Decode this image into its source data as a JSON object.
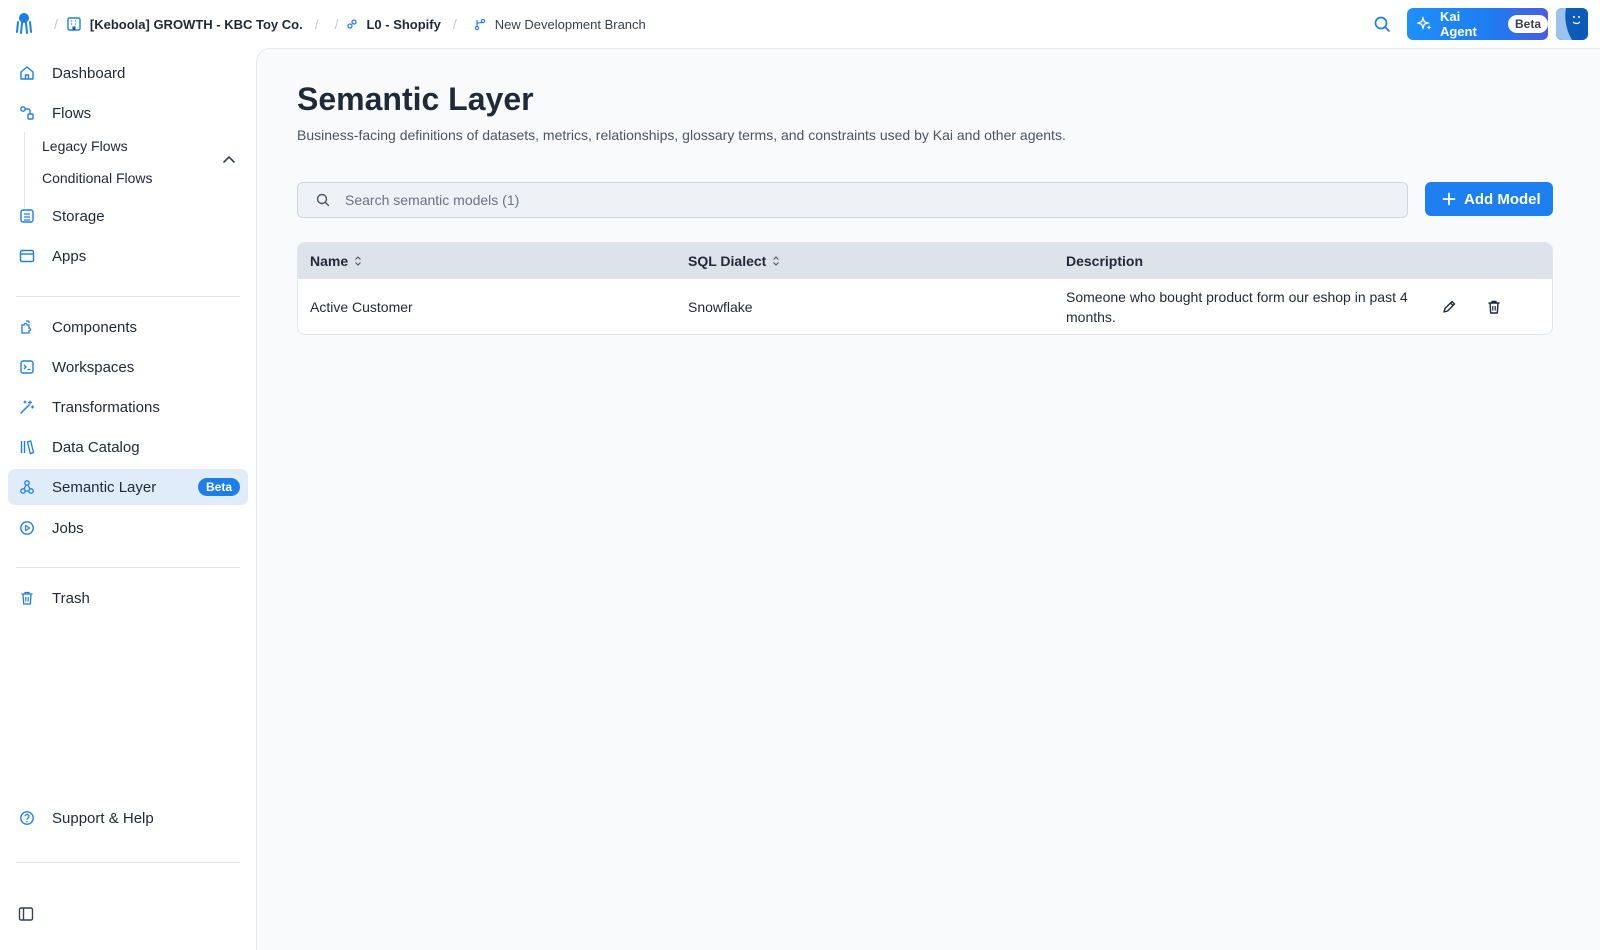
{
  "topbar": {
    "project": "[Keboola] GROWTH - KBC Toy Co.",
    "flow": "L0 - Shopify",
    "branch": "New Development Branch",
    "kai_label": "Kai Agent",
    "kai_badge": "Beta"
  },
  "sidebar": {
    "dashboard": "Dashboard",
    "flows": "Flows",
    "legacy_flows": "Legacy Flows",
    "conditional_flows": "Conditional Flows",
    "storage": "Storage",
    "apps": "Apps",
    "components": "Components",
    "workspaces": "Workspaces",
    "transformations": "Transformations",
    "data_catalog": "Data Catalog",
    "semantic_layer": "Semantic Layer",
    "semantic_badge": "Beta",
    "jobs": "Jobs",
    "trash": "Trash",
    "support": "Support & Help"
  },
  "main": {
    "title": "Semantic Layer",
    "description": "Business-facing definitions of datasets, metrics, relationships, glossary terms, and constraints used by Kai and other agents.",
    "search_placeholder": "Search semantic models (1)",
    "add_label": "Add Model",
    "table": {
      "headers": [
        "Name",
        "SQL Dialect",
        "Description"
      ],
      "rows": [
        {
          "name": "Active Customer",
          "dialect": "Snowflake",
          "description": "Someone who bought product form our eshop in past 4 months."
        }
      ]
    }
  },
  "colors": {
    "accent": "#1e80f0",
    "active_bg": "#e1ecfa",
    "icon": "#1e7ee8"
  }
}
